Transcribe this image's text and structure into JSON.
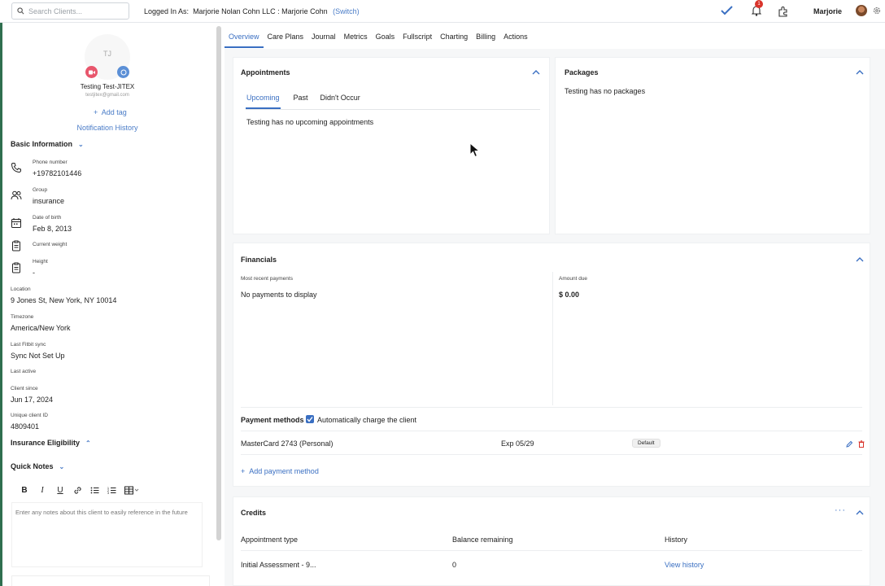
{
  "topbar": {
    "search_placeholder": "Search Clients...",
    "logged_in_label": "Logged In As:",
    "logged_in_org": "Marjorie Nolan Cohn LLC : Marjorie Cohn",
    "switch_label": "(Switch)",
    "notification_count": "1",
    "user_name": "Marjorie"
  },
  "client": {
    "initials": "TJ",
    "name": "Testing Test-JITEX",
    "email": "testjitex@gmail.com",
    "add_tag": "Add tag",
    "notification_history": "Notification History"
  },
  "basic_info": {
    "title": "Basic Information",
    "fields": [
      {
        "label": "Phone number",
        "value": "+19782101446",
        "icon": "phone-icon"
      },
      {
        "label": "Group",
        "value": "insurance",
        "icon": "group-icon"
      },
      {
        "label": "Date of birth",
        "value": "Feb 8, 2013",
        "icon": "calendar-icon"
      },
      {
        "label": "Current weight",
        "value": "",
        "icon": "clipboard-icon"
      },
      {
        "label": "Height",
        "value": "-",
        "icon": "clipboard-icon"
      }
    ],
    "location_label": "Location",
    "location": "9 Jones St, New York, NY 10014",
    "timezone_label": "Timezone",
    "timezone": "America/New York",
    "fitbit_label": "Last Fitbit sync",
    "fitbit": "Sync Not Set Up",
    "last_active_label": "Last active",
    "client_since_label": "Client since",
    "client_since": "Jun 17, 2024",
    "unique_id_label": "Unique client ID",
    "unique_id": "4809401"
  },
  "insurance_title": "Insurance Eligibility",
  "quick_notes": {
    "title": "Quick Notes",
    "placeholder": "Enter any notes about this client to easily reference in the future"
  },
  "tabs": [
    "Overview",
    "Care Plans",
    "Journal",
    "Metrics",
    "Goals",
    "Fullscript",
    "Charting",
    "Billing",
    "Actions"
  ],
  "appointments": {
    "title": "Appointments",
    "subtabs": [
      "Upcoming",
      "Past",
      "Didn't Occur"
    ],
    "empty": "Testing has no upcoming appointments"
  },
  "packages": {
    "title": "Packages",
    "empty": "Testing has no packages"
  },
  "financials": {
    "title": "Financials",
    "recent_label": "Most recent payments",
    "recent_empty": "No payments to display",
    "amount_due_label": "Amount due",
    "amount_due": "$ 0.00",
    "payment_methods_label": "Payment methods",
    "auto_charge": "Automatically charge the client",
    "card_name": "MasterCard 2743 (Personal)",
    "card_exp": "Exp 05/29",
    "card_badge": "Default",
    "add_payment": "Add payment method"
  },
  "credits": {
    "title": "Credits",
    "columns": [
      "Appointment type",
      "Balance remaining",
      "History"
    ],
    "rows": [
      {
        "type": "Initial Assessment - 9...",
        "balance": "0",
        "history": "View history"
      }
    ]
  },
  "colors": {
    "accent": "#3a6fc2",
    "badge": "#d9342b",
    "brand_edge": "#2f6f4f"
  }
}
